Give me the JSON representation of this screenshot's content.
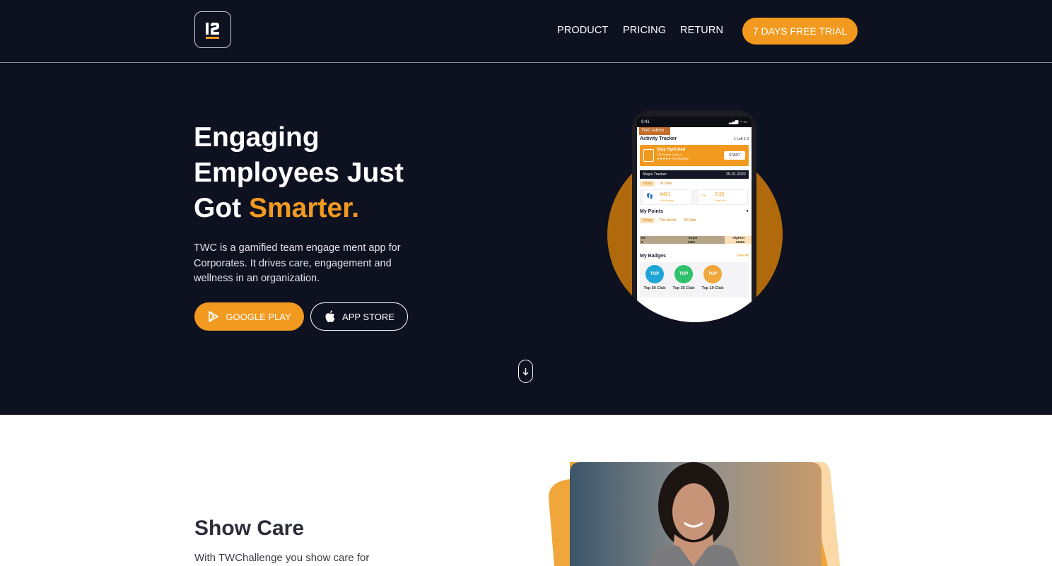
{
  "nav": {
    "logo_text": "12",
    "links": [
      {
        "label": "PRODUCT"
      },
      {
        "label": "PRICING"
      },
      {
        "label": "RETURN"
      }
    ],
    "trial_label": "7 DAYS FREE TRIAL"
  },
  "hero": {
    "headline_line1": "Engaging",
    "headline_line2": "Employees Just",
    "headline_line3_plain": "Got ",
    "headline_line3_accent": "Smarter.",
    "description": "TWC is a gamified team engage ment app for Corporates. It drives care, engagement and wellness in an organization.",
    "google_play_label": "GOOGLE PLAY",
    "app_store_label": "APP STORE"
  },
  "phone": {
    "time": "9:41",
    "admin_tag": "TWC Admin",
    "activity_title": "Activity Tracker",
    "counters": "1 Left 1 0",
    "card_title": "Stay Hydrated",
    "card_sub": "138 People Doing it",
    "card_reviews": "★★★★★ 745 Review",
    "card_button": "START",
    "steps_title": "Steps Tracker",
    "steps_date": "25-01-2022",
    "tab_today": "Today",
    "tab_till_date": "Till Date",
    "total_steps_value": "4401",
    "total_steps_label": "Total Steps",
    "total_km_value": "3.35",
    "total_km_label": "Total KM",
    "points_title": "My Points",
    "tab_this_month": "This Month",
    "points_progress": 0.74,
    "me_label": "Me",
    "me_value": "0",
    "target_label": "Target",
    "target_value": "2900",
    "highest_label": "Highest",
    "highest_value": "31060",
    "badges_title": "My Badges",
    "view_all": "View All",
    "badges": [
      {
        "label": "Top 50 Club",
        "text": "TOP",
        "color": "#1fa6d6"
      },
      {
        "label": "Top 35 Club",
        "text": "TOP",
        "color": "#2fc26b"
      },
      {
        "label": "Top 10 Club",
        "text": "TOP",
        "color": "#f0a63a"
      }
    ]
  },
  "section2": {
    "title": "Show Care",
    "text": "With TWChallenge you show care for"
  },
  "colors": {
    "accent": "#f29a1f",
    "hero_bg": "#0e1120"
  }
}
